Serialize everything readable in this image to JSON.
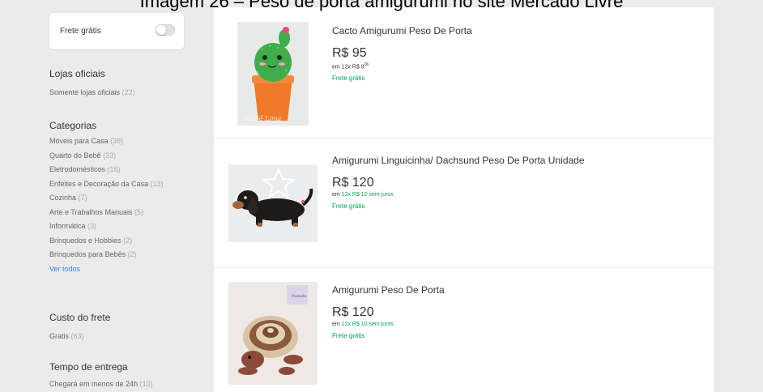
{
  "caption": "Imagem 26 – Peso de porta amigurumi no site Mercado Livre",
  "sidebar": {
    "free_shipping_label": "Frete grátis",
    "sections": [
      {
        "title": "Lojas oficiais",
        "items": [
          {
            "label": "Somente lojas oficiais",
            "count": "(22)"
          }
        ]
      },
      {
        "title": "Categorias",
        "items": [
          {
            "label": "Móveis para Casa",
            "count": "(38)"
          },
          {
            "label": "Quarto do Bebê",
            "count": "(33)"
          },
          {
            "label": "Eletrodomésticos",
            "count": "(16)"
          },
          {
            "label": "Enfeites e Decoração da Casa",
            "count": "(13)"
          },
          {
            "label": "Cozinha",
            "count": "(7)"
          },
          {
            "label": "Arte e Trabalhos Manuais",
            "count": "(5)"
          },
          {
            "label": "Informática",
            "count": "(3)"
          },
          {
            "label": "Brinquedos e Hobbies",
            "count": "(2)"
          },
          {
            "label": "Brinquedos para Bebês",
            "count": "(2)"
          }
        ],
        "see_all": "Ver todos"
      },
      {
        "title": "Custo do frete",
        "items": [
          {
            "label": "Gratis",
            "count": "(63)"
          }
        ]
      },
      {
        "title": "Tempo de entrega",
        "items": [
          {
            "label": "Chegará em menos de 24h",
            "count": "(10)"
          }
        ]
      }
    ]
  },
  "results": [
    {
      "title": "Cacto Amigurumi Peso De Porta",
      "price": "R$ 95",
      "installment_prefix": "em 12x R$ 9",
      "installment_cents": "06",
      "installment_suffix": "",
      "shipping": "Frete grátis",
      "watermark": "Ateliê Lima"
    },
    {
      "title": "Amigurumi Linguicinha/ Dachsund Peso De Porta Unidade",
      "price": "R$ 120",
      "installment_prefix": "em ",
      "installment_green": "12x R$ 10 sem juros",
      "shipping": "Frete grátis"
    },
    {
      "title": "Amigurumi Peso De Porta",
      "price": "R$ 120",
      "installment_prefix": "em ",
      "installment_green": "12x R$ 10 sem juros",
      "shipping": "Frete grátis",
      "logo_text": "Pamela"
    }
  ]
}
